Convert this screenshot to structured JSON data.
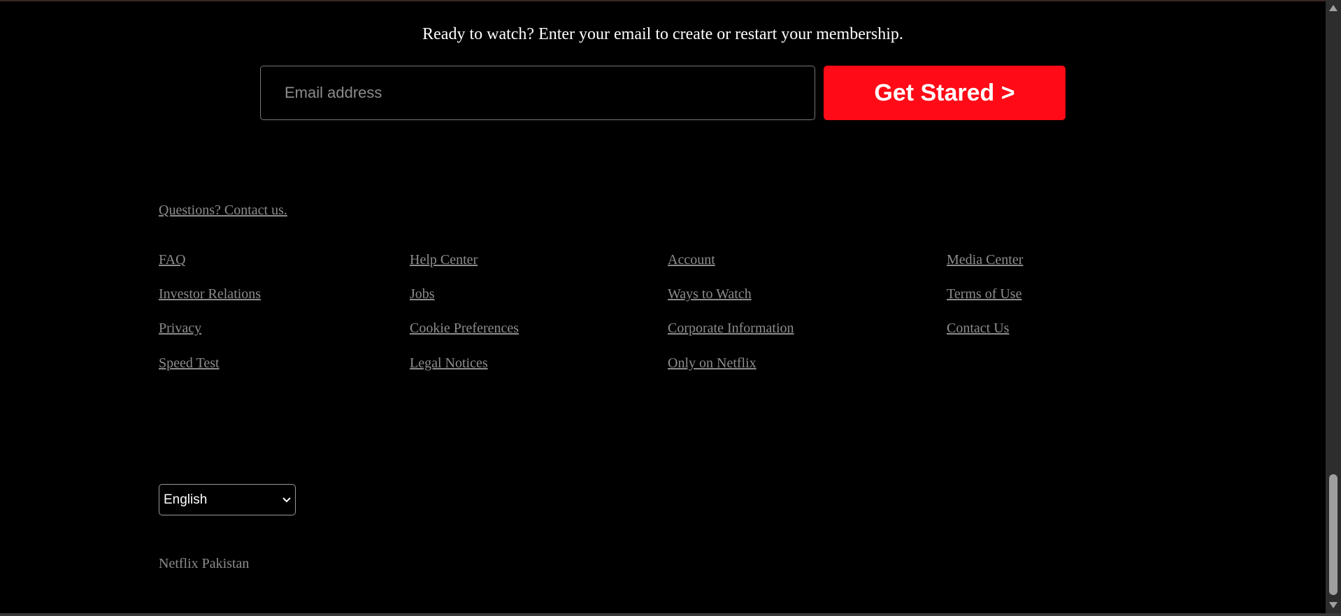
{
  "signup": {
    "heading": "Ready to watch? Enter your email to create or restart your membership.",
    "email_placeholder": "Email address",
    "email_value": "",
    "cta_label": "Get Stared >"
  },
  "footer": {
    "contact_link": "Questions? Contact us.",
    "columns": [
      [
        "FAQ",
        "Investor Relations",
        "Privacy",
        "Speed Test"
      ],
      [
        "Help Center",
        "Jobs",
        "Cookie Preferences",
        "Legal Notices"
      ],
      [
        "Account",
        "Ways to Watch",
        "Corporate Information",
        "Only on Netflix"
      ],
      [
        "Media Center",
        "Terms of Use",
        "Contact Us"
      ]
    ],
    "language_selected": "English",
    "country": "Netflix Pakistan"
  },
  "colors": {
    "accent": "#ff0a16",
    "link": "#8c8c8c",
    "background": "#000000"
  }
}
